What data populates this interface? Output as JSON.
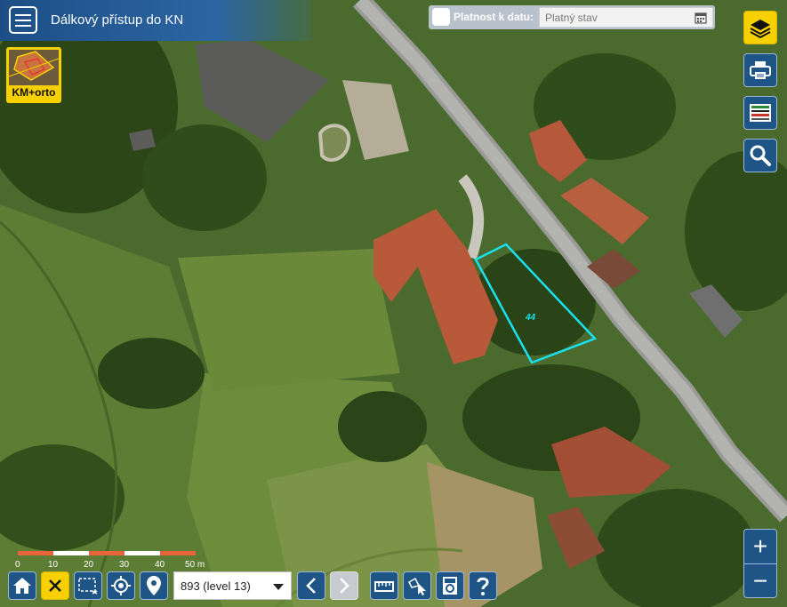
{
  "app": {
    "title": "Dálkový přístup do KN"
  },
  "validity": {
    "label": "Platnost k datu:",
    "placeholder": "Platný stav"
  },
  "layer_switch": {
    "label": "KM+orto"
  },
  "map": {
    "parcel_label": "44"
  },
  "scale": {
    "ticks": [
      "0",
      "10",
      "20",
      "30",
      "40",
      "50 m"
    ]
  },
  "scale_selector": {
    "value": "893 (level 13)"
  },
  "right_toolbar": {
    "icons": [
      "layers-icon",
      "print-icon",
      "legend-icon",
      "search-icon"
    ]
  },
  "bottom_toolbar": {
    "icons": [
      "home-icon",
      "close-icon",
      "select-area-icon",
      "locate-icon",
      "marker-icon",
      "prev-icon",
      "next-icon",
      "measure-icon",
      "select-parcel-icon",
      "pdf-icon",
      "help-icon"
    ]
  },
  "zoom": {
    "in": "+",
    "out": "−"
  },
  "colors": {
    "primary": "#1f5586",
    "accent": "#f6d000",
    "parcel_outline": "#19e2f0"
  }
}
